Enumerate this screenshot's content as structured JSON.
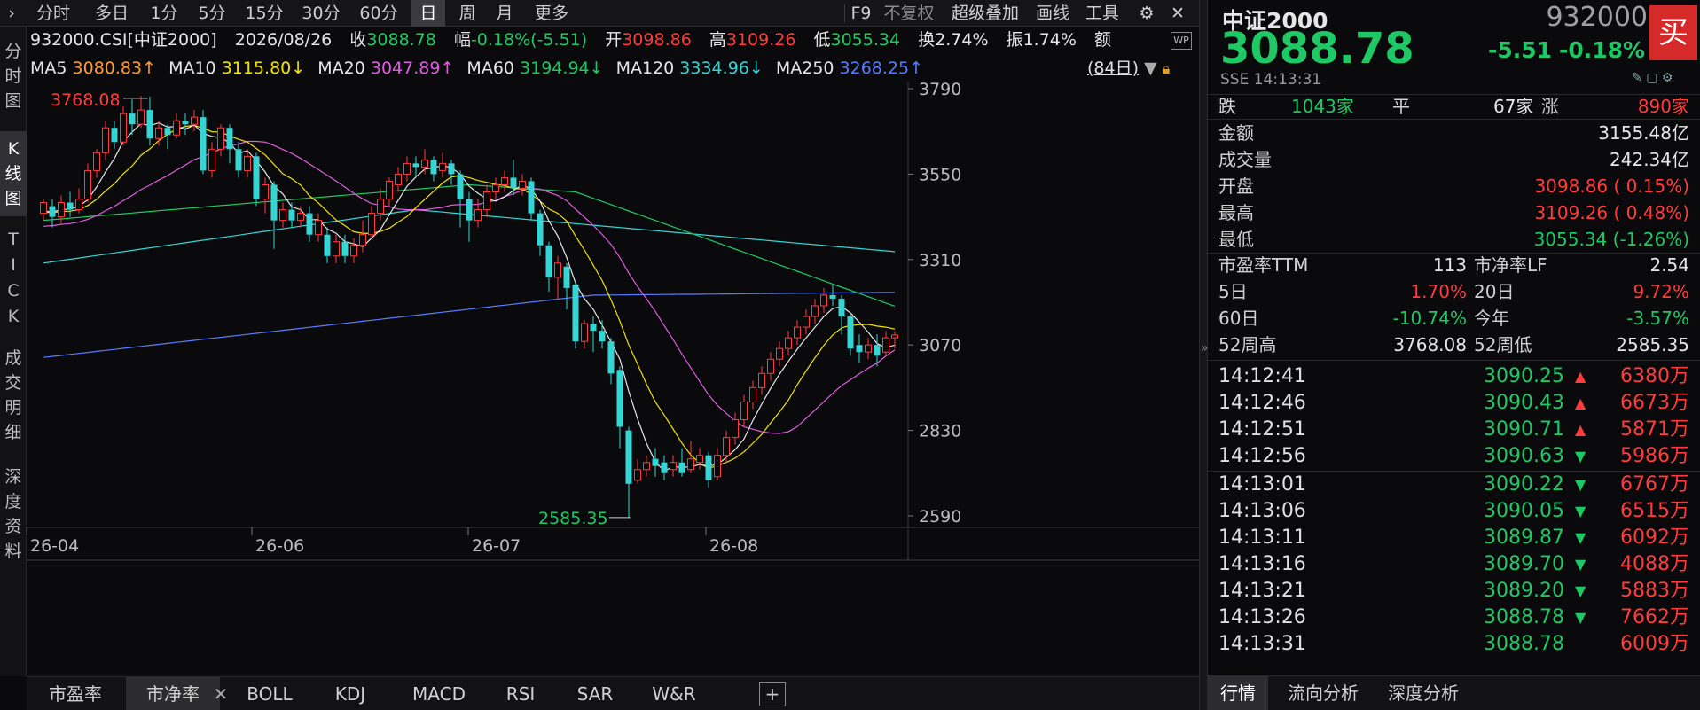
{
  "toolbar": {
    "left_items": [
      "分时",
      "多日",
      "1分",
      "5分",
      "15分",
      "30分",
      "60分",
      "日",
      "周",
      "月",
      "更多"
    ],
    "active_index": 7,
    "right_items": [
      "F9",
      "不复权",
      "超级叠加",
      "画线",
      "工具"
    ]
  },
  "left_tabs": [
    {
      "label": "分时图",
      "active": false
    },
    {
      "label": "K线图",
      "active": true
    },
    {
      "label": "TICK",
      "active": false
    },
    {
      "label": "成交明细",
      "active": false
    },
    {
      "label": "深度资料",
      "active": false
    }
  ],
  "info": {
    "code_name": "932000.CSI[中证2000]",
    "date": "2026/08/26",
    "close_label": "收",
    "close": "3088.78",
    "change_label": "幅",
    "change": "-0.18%(-5.51)",
    "open_label": "开",
    "open": "3098.86",
    "high_label": "高",
    "high": "3109.26",
    "low_label": "低",
    "low": "3055.34",
    "turnover_label": "换",
    "turnover": "2.74%",
    "amplitude_label": "振",
    "amplitude": "1.74%",
    "amount_label": "额"
  },
  "ma": {
    "ma5_label": "MA5",
    "ma5": "3080.83↑",
    "ma10_label": "MA10",
    "ma10": "3115.80↓",
    "ma20_label": "MA20",
    "ma20": "3047.89↑",
    "ma60_label": "MA60",
    "ma60": "3194.94↓",
    "ma120_label": "MA120",
    "ma120": "3334.96↓",
    "ma250_label": "MA250",
    "ma250": "3268.25↑",
    "period": "(84日)"
  },
  "colors": {
    "up": "#ff3b3b",
    "down": "#35d5d5",
    "ma5": "#e8e8e8",
    "ma10": "#f2e400",
    "ma20": "#e05ce0",
    "ma60": "#1ec864",
    "ma120": "#35d5d5",
    "ma250": "#5a7cff"
  },
  "chart_data": {
    "type": "candlestick",
    "ylim": [
      2560,
      3810
    ],
    "y_ticks": [
      "3790",
      "3550",
      "3310",
      "3070",
      "2830",
      "2590"
    ],
    "x_ticks": [
      "26-04",
      "26-06",
      "26-07",
      "26-08"
    ],
    "high_marker": "3768.08",
    "low_marker": "2585.35",
    "candles": [
      [
        3440,
        3470,
        3420,
        3480
      ],
      [
        3460,
        3430,
        3400,
        3480
      ],
      [
        3430,
        3470,
        3410,
        3490
      ],
      [
        3470,
        3450,
        3430,
        3500
      ],
      [
        3450,
        3480,
        3440,
        3510
      ],
      [
        3480,
        3560,
        3470,
        3580
      ],
      [
        3560,
        3610,
        3540,
        3620
      ],
      [
        3610,
        3680,
        3590,
        3700
      ],
      [
        3680,
        3640,
        3620,
        3700
      ],
      [
        3640,
        3720,
        3630,
        3740
      ],
      [
        3720,
        3690,
        3660,
        3760
      ],
      [
        3690,
        3730,
        3680,
        3770
      ],
      [
        3730,
        3650,
        3630,
        3768
      ],
      [
        3650,
        3680,
        3630,
        3700
      ],
      [
        3680,
        3660,
        3620,
        3690
      ],
      [
        3660,
        3700,
        3650,
        3720
      ],
      [
        3700,
        3690,
        3660,
        3720
      ],
      [
        3690,
        3710,
        3670,
        3730
      ],
      [
        3710,
        3560,
        3550,
        3730
      ],
      [
        3560,
        3620,
        3540,
        3640
      ],
      [
        3620,
        3680,
        3600,
        3690
      ],
      [
        3680,
        3620,
        3580,
        3690
      ],
      [
        3620,
        3560,
        3540,
        3640
      ],
      [
        3560,
        3600,
        3540,
        3620
      ],
      [
        3600,
        3480,
        3460,
        3610
      ],
      [
        3480,
        3520,
        3440,
        3540
      ],
      [
        3520,
        3420,
        3340,
        3530
      ],
      [
        3420,
        3450,
        3400,
        3470
      ],
      [
        3450,
        3420,
        3400,
        3470
      ],
      [
        3420,
        3440,
        3400,
        3460
      ],
      [
        3440,
        3380,
        3360,
        3460
      ],
      [
        3380,
        3420,
        3360,
        3440
      ],
      [
        3380,
        3320,
        3300,
        3400
      ],
      [
        3320,
        3360,
        3300,
        3380
      ],
      [
        3360,
        3320,
        3300,
        3380
      ],
      [
        3320,
        3350,
        3300,
        3370
      ],
      [
        3350,
        3380,
        3330,
        3420
      ],
      [
        3380,
        3440,
        3370,
        3460
      ],
      [
        3440,
        3480,
        3420,
        3510
      ],
      [
        3480,
        3530,
        3460,
        3540
      ],
      [
        3520,
        3550,
        3500,
        3570
      ],
      [
        3550,
        3580,
        3530,
        3600
      ],
      [
        3580,
        3570,
        3540,
        3600
      ],
      [
        3570,
        3590,
        3550,
        3620
      ],
      [
        3590,
        3550,
        3530,
        3600
      ],
      [
        3560,
        3580,
        3540,
        3610
      ],
      [
        3580,
        3550,
        3520,
        3590
      ],
      [
        3550,
        3480,
        3400,
        3560
      ],
      [
        3480,
        3420,
        3360,
        3500
      ],
      [
        3420,
        3450,
        3400,
        3480
      ],
      [
        3450,
        3500,
        3430,
        3520
      ],
      [
        3500,
        3520,
        3480,
        3540
      ],
      [
        3520,
        3540,
        3500,
        3560
      ],
      [
        3540,
        3510,
        3490,
        3590
      ],
      [
        3510,
        3530,
        3490,
        3550
      ],
      [
        3530,
        3440,
        3420,
        3540
      ],
      [
        3440,
        3350,
        3320,
        3450
      ],
      [
        3350,
        3260,
        3220,
        3360
      ],
      [
        3260,
        3300,
        3200,
        3320
      ],
      [
        3290,
        3230,
        3170,
        3300
      ],
      [
        3240,
        3080,
        3060,
        3250
      ],
      [
        3080,
        3130,
        3060,
        3140
      ],
      [
        3130,
        3110,
        3050,
        3150
      ],
      [
        3110,
        3080,
        3060,
        3140
      ],
      [
        3080,
        2990,
        2960,
        3090
      ],
      [
        3000,
        2840,
        2780,
        3010
      ],
      [
        2830,
        2680,
        2585,
        2840
      ],
      [
        2690,
        2720,
        2680,
        2750
      ],
      [
        2720,
        2740,
        2700,
        2760
      ],
      [
        2750,
        2730,
        2700,
        2780
      ],
      [
        2740,
        2710,
        2690,
        2760
      ],
      [
        2720,
        2740,
        2700,
        2760
      ],
      [
        2740,
        2710,
        2700,
        2780
      ],
      [
        2720,
        2750,
        2710,
        2800
      ],
      [
        2740,
        2760,
        2720,
        2780
      ],
      [
        2760,
        2690,
        2670,
        2770
      ],
      [
        2700,
        2760,
        2690,
        2780
      ],
      [
        2760,
        2810,
        2740,
        2830
      ],
      [
        2810,
        2860,
        2790,
        2880
      ],
      [
        2860,
        2910,
        2840,
        2930
      ],
      [
        2910,
        2950,
        2890,
        2970
      ],
      [
        2950,
        2990,
        2930,
        3010
      ],
      [
        2990,
        3030,
        2970,
        3050
      ],
      [
        3030,
        3060,
        3010,
        3080
      ],
      [
        3060,
        3090,
        3040,
        3110
      ],
      [
        3090,
        3120,
        3070,
        3140
      ],
      [
        3120,
        3150,
        3100,
        3170
      ],
      [
        3150,
        3180,
        3130,
        3200
      ],
      [
        3180,
        3210,
        3160,
        3230
      ],
      [
        3210,
        3200,
        3180,
        3240
      ],
      [
        3200,
        3150,
        3100,
        3210
      ],
      [
        3150,
        3060,
        3040,
        3160
      ],
      [
        3070,
        3050,
        3020,
        3100
      ],
      [
        3050,
        3070,
        3030,
        3090
      ],
      [
        3070,
        3040,
        3010,
        3100
      ],
      [
        3050,
        3090,
        3040,
        3110
      ],
      [
        3090,
        3098,
        3060,
        3109
      ]
    ]
  },
  "indicator_tabs": [
    "市盈率",
    "市净率",
    "BOLL",
    "KDJ",
    "MACD",
    "RSI",
    "SAR",
    "W&R"
  ],
  "indicator_active": 1,
  "right_panel": {
    "name": "中证2000",
    "code": "932000",
    "price": "3088.78",
    "change": "-5.51",
    "change_pct": "-0.18%",
    "market_time": "SSE  14:13:31",
    "buy_label": "买",
    "breadth": {
      "down_label": "跌",
      "down": "1043家",
      "flat_label": "平",
      "flat": "67家",
      "up_label": "涨",
      "up": "890家"
    },
    "stats": [
      {
        "label": "金额",
        "value": "3155.48亿",
        "color": "white"
      },
      {
        "label": "成交量",
        "value": "242.34亿",
        "color": "white"
      },
      {
        "label": "开盘",
        "value": "3098.86 ( 0.15%)",
        "color": "red"
      },
      {
        "label": "最高",
        "value": "3109.26 ( 0.48%)",
        "color": "red"
      },
      {
        "label": "最低",
        "value": "3055.34 (-1.26%)",
        "color": "green"
      }
    ],
    "metrics": [
      {
        "l1": "市盈率TTM",
        "v1": "113",
        "c1": "white",
        "l2": "市净率LF",
        "v2": "2.54",
        "c2": "white"
      },
      {
        "l1": "5日",
        "v1": "1.70%",
        "c1": "red",
        "l2": "20日",
        "v2": "9.72%",
        "c2": "red"
      },
      {
        "l1": "60日",
        "v1": "-10.74%",
        "c1": "green",
        "l2": "今年",
        "v2": "-3.57%",
        "c2": "green"
      },
      {
        "l1": "52周高",
        "v1": "3768.08",
        "c1": "white",
        "l2": "52周低",
        "v2": "2585.35",
        "c2": "white"
      }
    ],
    "ticks": [
      {
        "time": "14:12:41",
        "price": "3090.25",
        "dir": "up",
        "vol": "6380万"
      },
      {
        "time": "14:12:46",
        "price": "3090.43",
        "dir": "up",
        "vol": "6673万"
      },
      {
        "time": "14:12:51",
        "price": "3090.71",
        "dir": "up",
        "vol": "5871万"
      },
      {
        "time": "14:12:56",
        "price": "3090.63",
        "dir": "down",
        "vol": "5986万"
      },
      {
        "time": "14:13:01",
        "price": "3090.22",
        "dir": "down",
        "vol": "6767万"
      },
      {
        "time": "14:13:06",
        "price": "3090.05",
        "dir": "down",
        "vol": "6515万"
      },
      {
        "time": "14:13:11",
        "price": "3089.87",
        "dir": "down",
        "vol": "6092万"
      },
      {
        "time": "14:13:16",
        "price": "3089.70",
        "dir": "down",
        "vol": "4088万"
      },
      {
        "time": "14:13:21",
        "price": "3089.20",
        "dir": "down",
        "vol": "5883万"
      },
      {
        "time": "14:13:26",
        "price": "3088.78",
        "dir": "down",
        "vol": "7662万"
      },
      {
        "time": "14:13:31",
        "price": "3088.78",
        "dir": "none",
        "vol": "6009万"
      }
    ],
    "bottom_tabs": [
      "行情",
      "流向分析",
      "深度分析"
    ],
    "bottom_active": 0
  }
}
